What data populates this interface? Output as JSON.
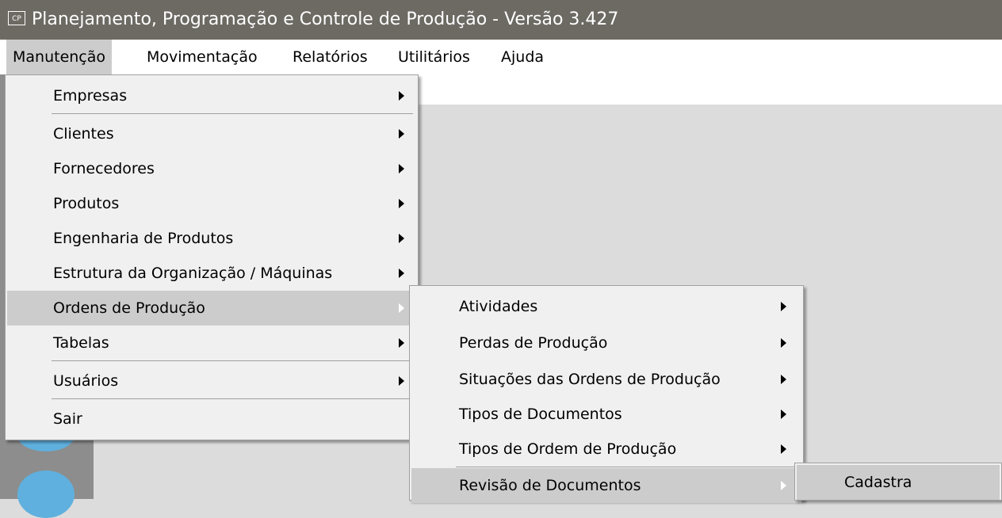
{
  "window": {
    "icon_text": "CP",
    "title": "Planejamento, Programação e Controle de Produção - Versão 3.427"
  },
  "menubar": {
    "items": [
      "Manutenção",
      "Movimentação",
      "Relatórios",
      "Utilitários",
      "Ajuda"
    ]
  },
  "menu_manutencao": {
    "items": [
      {
        "label": "Empresas"
      },
      {
        "label": "Clientes"
      },
      {
        "label": "Fornecedores"
      },
      {
        "label": "Produtos"
      },
      {
        "label": "Engenharia de Produtos"
      },
      {
        "label": "Estrutura da Organização / Máquinas"
      },
      {
        "label": "Ordens de Produção"
      },
      {
        "label": "Tabelas"
      },
      {
        "label": "Usuários"
      },
      {
        "label": "Sair"
      }
    ]
  },
  "menu_ordens": {
    "items": [
      {
        "label": "Atividades"
      },
      {
        "label": "Perdas de Produção"
      },
      {
        "label": "Situações das Ordens de Produção"
      },
      {
        "label": "Tipos de Documentos"
      },
      {
        "label": "Tipos de Ordem de Produção"
      },
      {
        "label": "Revisão de Documentos"
      }
    ]
  },
  "menu_revisao": {
    "items": [
      {
        "label": "Cadastra"
      }
    ]
  },
  "colors": {
    "titlebar": "#6d6a64",
    "highlight": "#cccccc",
    "menu_bg": "#f0f0f0",
    "accent_icon": "#5fb0de"
  }
}
